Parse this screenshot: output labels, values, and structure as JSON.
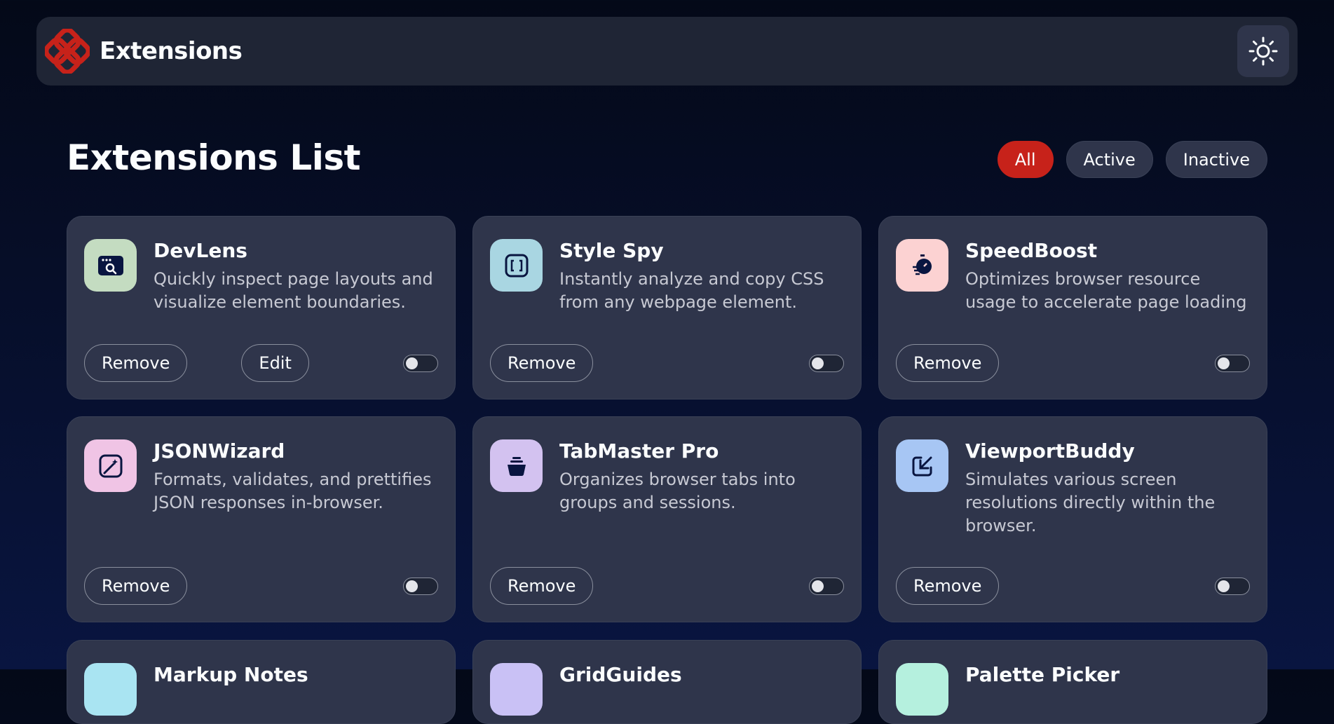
{
  "header": {
    "title": "Extensions",
    "theme_icon": "sun-icon",
    "brand_color": "#c7221a"
  },
  "main": {
    "title": "Extensions List",
    "filters": [
      "All",
      "Active",
      "Inactive"
    ],
    "selected_filter": "All"
  },
  "cards": [
    {
      "name": "DevLens",
      "description": "Quickly inspect page layouts and visualize element boundaries.",
      "icon": "browser-search-icon",
      "icon_bg": "#c4dcc1",
      "actions": [
        "Remove",
        "Edit"
      ],
      "active": false
    },
    {
      "name": "Style Spy",
      "description": "Instantly analyze and copy CSS from any webpage element.",
      "icon": "code-brackets-icon",
      "icon_bg": "#a9d6e2",
      "actions": [
        "Remove"
      ],
      "active": false
    },
    {
      "name": "SpeedBoost",
      "description": "Optimizes browser resource usage to accelerate page loading",
      "icon": "stopwatch-icon",
      "icon_bg": "#fcd2d2",
      "actions": [
        "Remove"
      ],
      "active": false
    },
    {
      "name": "JSONWizard",
      "description": "Formats, validates, and prettifies JSON responses in-browser.",
      "icon": "magic-wand-icon",
      "icon_bg": "#f0c4e5",
      "actions": [
        "Remove"
      ],
      "active": false
    },
    {
      "name": "TabMaster Pro",
      "description": "Organizes browser tabs into groups and sessions.",
      "icon": "stack-bowl-icon",
      "icon_bg": "#d3c2f0",
      "actions": [
        "Remove"
      ],
      "active": false
    },
    {
      "name": "ViewportBuddy",
      "description": "Simulates various screen resolutions directly within the browser.",
      "icon": "expand-arrow-icon",
      "icon_bg": "#a7c6f4",
      "actions": [
        "Remove"
      ],
      "active": false
    },
    {
      "name": "Markup Notes",
      "icon": "notes-icon",
      "icon_bg": "#a9e4f2"
    },
    {
      "name": "GridGuides",
      "icon": "grid-icon",
      "icon_bg": "#c9c1f5"
    },
    {
      "name": "Palette Picker",
      "icon": "palette-icon",
      "icon_bg": "#b5f0de"
    }
  ]
}
